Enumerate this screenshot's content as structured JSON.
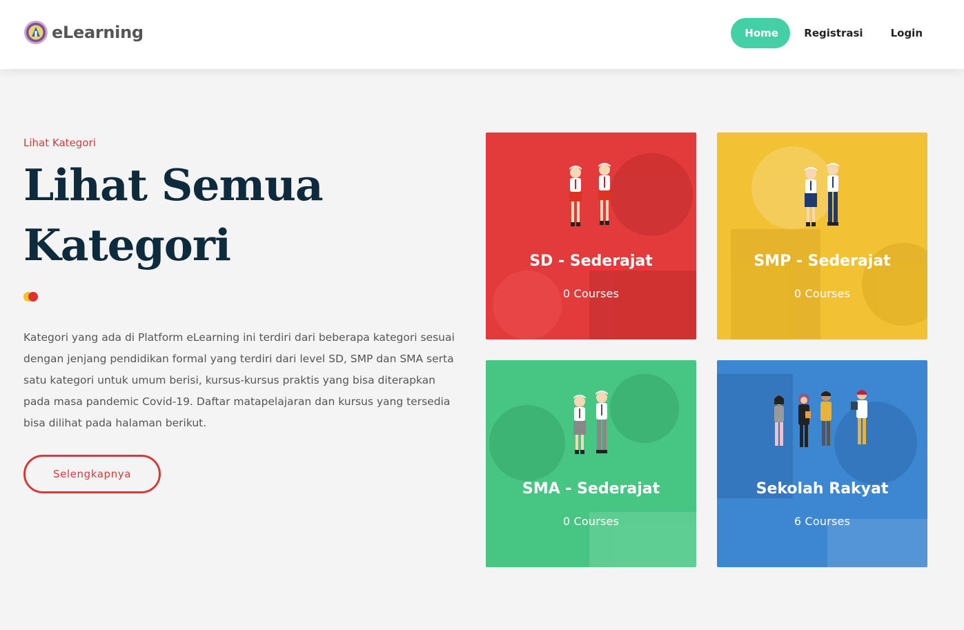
{
  "brand": {
    "name": "eLearning",
    "logo_icon": "university-emblem-icon"
  },
  "nav": {
    "items": [
      {
        "label": "Home",
        "active": true
      },
      {
        "label": "Registrasi",
        "active": false
      },
      {
        "label": "Login",
        "active": false
      }
    ],
    "accent": "#45cfa6"
  },
  "hero": {
    "eyebrow": "Lihat Kategori",
    "title": "Lihat Semua Kategori",
    "description": "Kategori yang ada di Platform eLearning ini terdiri dari beberapa kategori sesuai dengan jenjang pendidikan formal yang terdiri dari level SD, SMP dan SMA serta satu kategori untuk umum berisi, kursus-kursus praktis yang bisa diterapkan pada masa pandemic Covid-19. Daftar matapelajaran dan kursus yang tersedia bisa dilihat pada halaman berikut.",
    "button_label": "Selengkapnya",
    "accent": "#d33b3b"
  },
  "categories": [
    {
      "title": "SD - Sederajat",
      "count": "0 Courses",
      "color": "#e33b3b",
      "illustration": "elementary-students-icon"
    },
    {
      "title": "SMP - Sederajat",
      "count": "0 Courses",
      "color": "#f2c134",
      "illustration": "junior-high-students-icon"
    },
    {
      "title": "SMA - Sederajat",
      "count": "0 Courses",
      "color": "#47c582",
      "illustration": "senior-high-students-icon"
    },
    {
      "title": "Sekolah Rakyat",
      "count": "6 Courses",
      "color": "#3d86d1",
      "illustration": "adult-learners-icon"
    }
  ]
}
